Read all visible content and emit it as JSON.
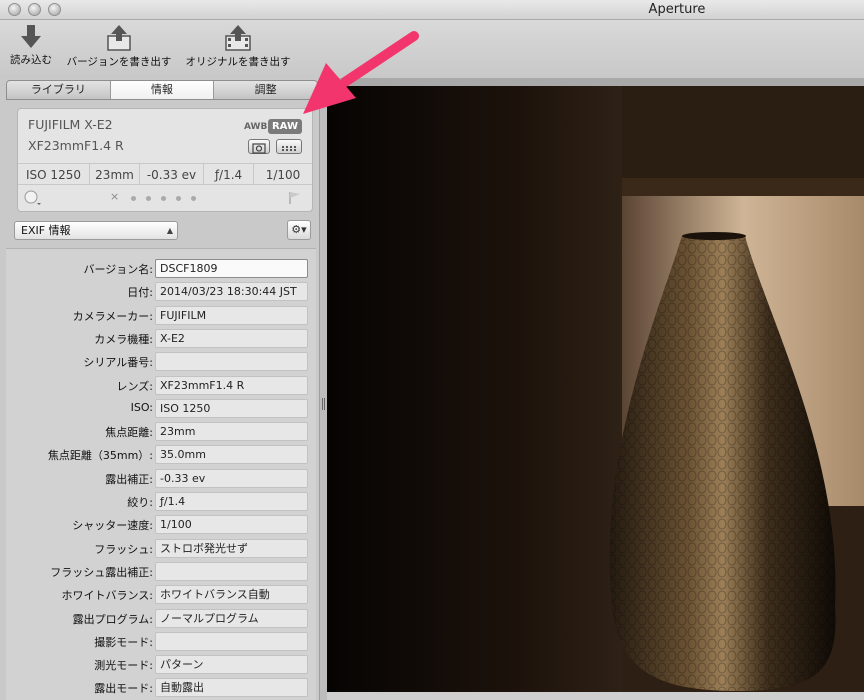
{
  "window": {
    "title": "Aperture"
  },
  "toolbar": {
    "import_label": "読み込む",
    "export_version_label": "バージョンを書き出す",
    "export_original_label": "オリジナルを書き出す"
  },
  "tabs": [
    {
      "label": "ライブラリ"
    },
    {
      "label": "情報"
    },
    {
      "label": "調整"
    }
  ],
  "infobox": {
    "camera": "FUJIFILM X-E2",
    "lens": "XF23mmF1.4 R",
    "awb": "AWB",
    "raw": "RAW",
    "stats": [
      "ISO 1250",
      "23mm",
      "-0.33 ev",
      "ƒ/1.4",
      "1/100"
    ]
  },
  "metadata_view": {
    "selected": "EXIF 情報"
  },
  "fields": [
    {
      "label": "バージョン名:",
      "value": "DSCF1809"
    },
    {
      "label": "日付:",
      "value": "2014/03/23 18:30:44 JST"
    },
    {
      "label": "カメラメーカー:",
      "value": "FUJIFILM"
    },
    {
      "label": "カメラ機種:",
      "value": "X-E2"
    },
    {
      "label": "シリアル番号:",
      "value": ""
    },
    {
      "label": "レンズ:",
      "value": "XF23mmF1.4 R"
    },
    {
      "label": "ISO:",
      "value": "ISO 1250"
    },
    {
      "label": "焦点距離:",
      "value": "23mm"
    },
    {
      "label": "焦点距離（35mm）:",
      "value": "35.0mm"
    },
    {
      "label": "露出補正:",
      "value": "-0.33 ev"
    },
    {
      "label": "絞り:",
      "value": "ƒ/1.4"
    },
    {
      "label": "シャッター速度:",
      "value": "1/100"
    },
    {
      "label": "フラッシュ:",
      "value": "ストロボ発光せず"
    },
    {
      "label": "フラッシュ露出補正:",
      "value": ""
    },
    {
      "label": "ホワイトバランス:",
      "value": "ホワイトバランス自動"
    },
    {
      "label": "露出プログラム:",
      "value": "ノーマルプログラム"
    },
    {
      "label": "撮影モード:",
      "value": ""
    },
    {
      "label": "測光モード:",
      "value": "パターン"
    },
    {
      "label": "露出モード:",
      "value": "自動露出"
    }
  ],
  "colors": {
    "annotation_arrow": "#f2356c",
    "raw_badge": "#7a7a7a"
  },
  "icons": {
    "import": "download-arrow-icon",
    "export_version": "export-tray-icon",
    "export_original": "export-film-tray-icon",
    "rating": "star-circle-icon",
    "reject": "x-icon",
    "flag": "flag-icon",
    "gear": "gear-icon"
  }
}
